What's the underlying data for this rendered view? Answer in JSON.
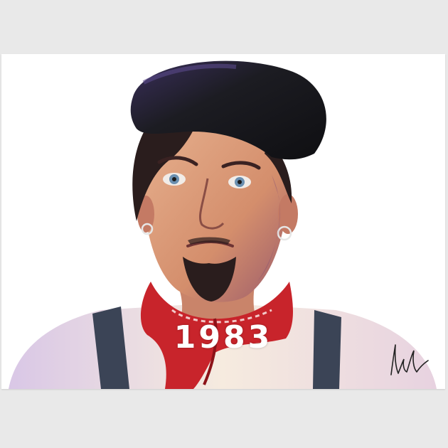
{
  "poster": {
    "year_text": "1983",
    "colors": {
      "background": "#e9e9e9",
      "paper": "#ffffff",
      "beret": "#1c1c22",
      "bandana": "#c8242b",
      "skin": "#d99a7a",
      "hair": "#2a1d1d",
      "suspenders": "#3b4456",
      "shirt": "#f3e6d8"
    },
    "icons": {
      "signature": "signature-icon",
      "earring": "hoop-earring-icon"
    }
  }
}
